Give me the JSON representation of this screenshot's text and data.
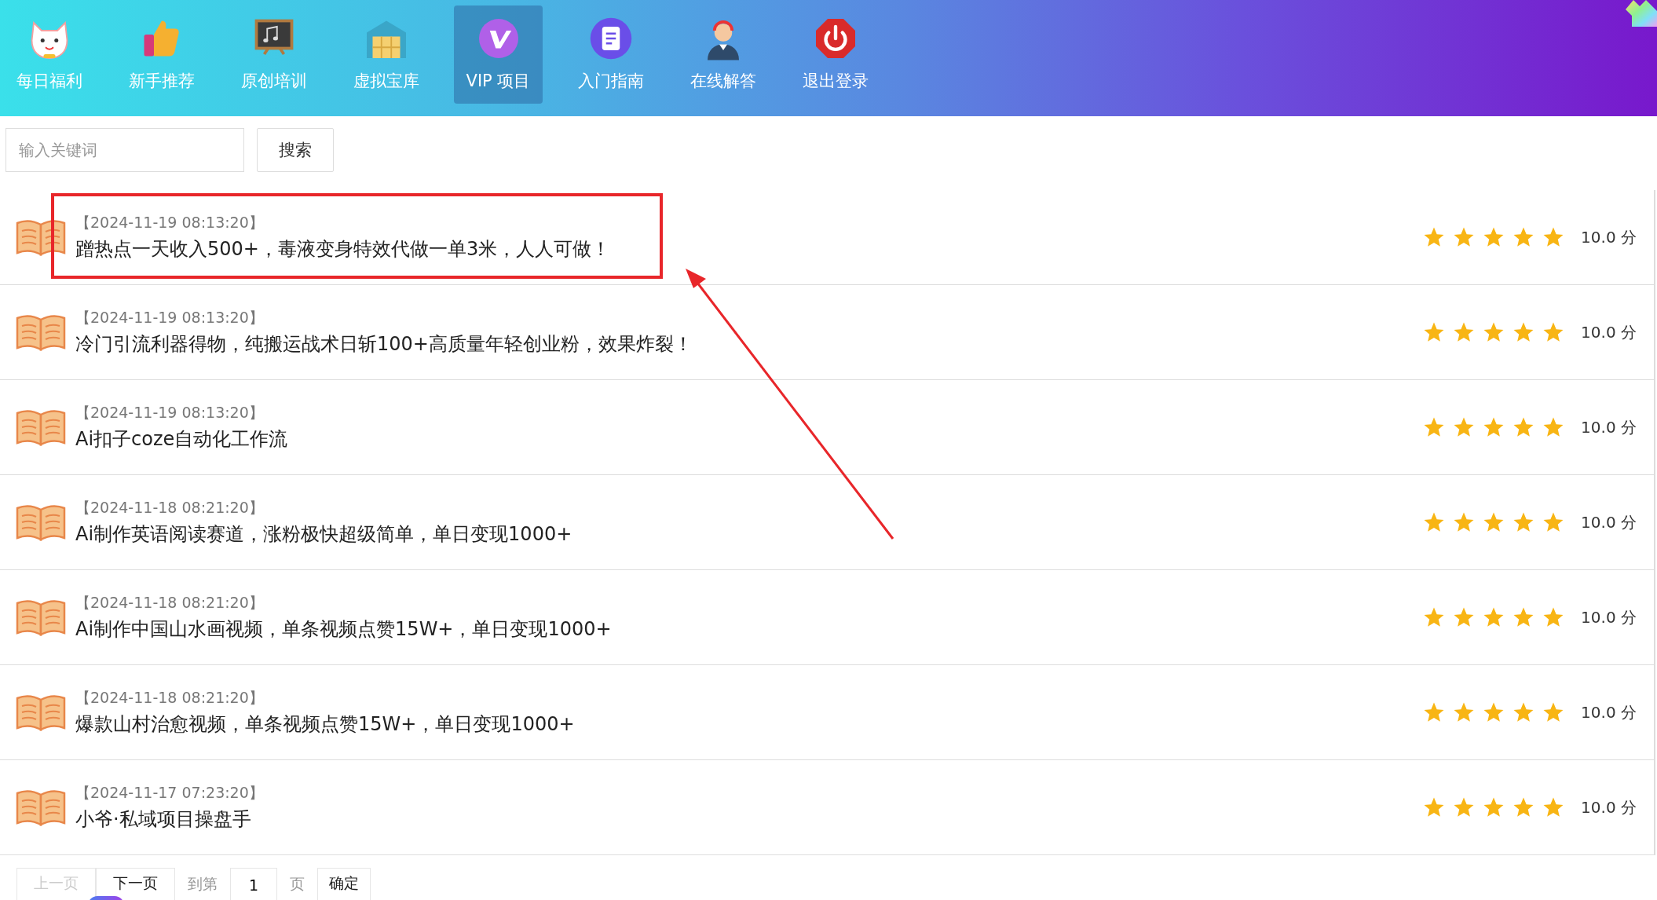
{
  "nav": [
    {
      "label": "每日福利",
      "selected": false,
      "kind": "cat"
    },
    {
      "label": "新手推荐",
      "selected": false,
      "kind": "thumb"
    },
    {
      "label": "原创培训",
      "selected": false,
      "kind": "board"
    },
    {
      "label": "虚拟宝库",
      "selected": false,
      "kind": "warehouse"
    },
    {
      "label": "VIP 项目",
      "selected": true,
      "kind": "vip"
    },
    {
      "label": "入门指南",
      "selected": false,
      "kind": "doc"
    },
    {
      "label": "在线解答",
      "selected": false,
      "kind": "agent"
    },
    {
      "label": "退出登录",
      "selected": false,
      "kind": "power"
    }
  ],
  "search": {
    "placeholder": "输入关键词",
    "button": "搜索"
  },
  "rows": [
    {
      "date": "【2024-11-19 08:13:20】",
      "title": "蹭热点一天收入500+，毒液变身特效代做一单3米，人人可做！",
      "stars": 5,
      "score": "10.0 分"
    },
    {
      "date": "【2024-11-19 08:13:20】",
      "title": "冷门引流利器得物，纯搬运战术日斩100+高质量年轻创业粉，效果炸裂！",
      "stars": 5,
      "score": "10.0 分"
    },
    {
      "date": "【2024-11-19 08:13:20】",
      "title": "Ai扣子coze自动化工作流",
      "stars": 5,
      "score": "10.0 分"
    },
    {
      "date": "【2024-11-18 08:21:20】",
      "title": "Ai制作英语阅读赛道，涨粉极快超级简单，单日变现1000+",
      "stars": 5,
      "score": "10.0 分"
    },
    {
      "date": "【2024-11-18 08:21:20】",
      "title": "Ai制作中国山水画视频，单条视频点赞15W+，单日变现1000+",
      "stars": 5,
      "score": "10.0 分"
    },
    {
      "date": "【2024-11-18 08:21:20】",
      "title": "爆款山村治愈视频，单条视频点赞15W+，单日变现1000+",
      "stars": 5,
      "score": "10.0 分"
    },
    {
      "date": "【2024-11-17 07:23:20】",
      "title": "小爷·私域项目操盘手",
      "stars": 5,
      "score": "10.0 分"
    }
  ],
  "pagination": {
    "prev": {
      "label": "上一页",
      "disabled": true
    },
    "next": {
      "label": "下一页",
      "disabled": false
    },
    "goto_label": "到第",
    "page": "1",
    "page_unit": "页",
    "confirm": "确定"
  }
}
